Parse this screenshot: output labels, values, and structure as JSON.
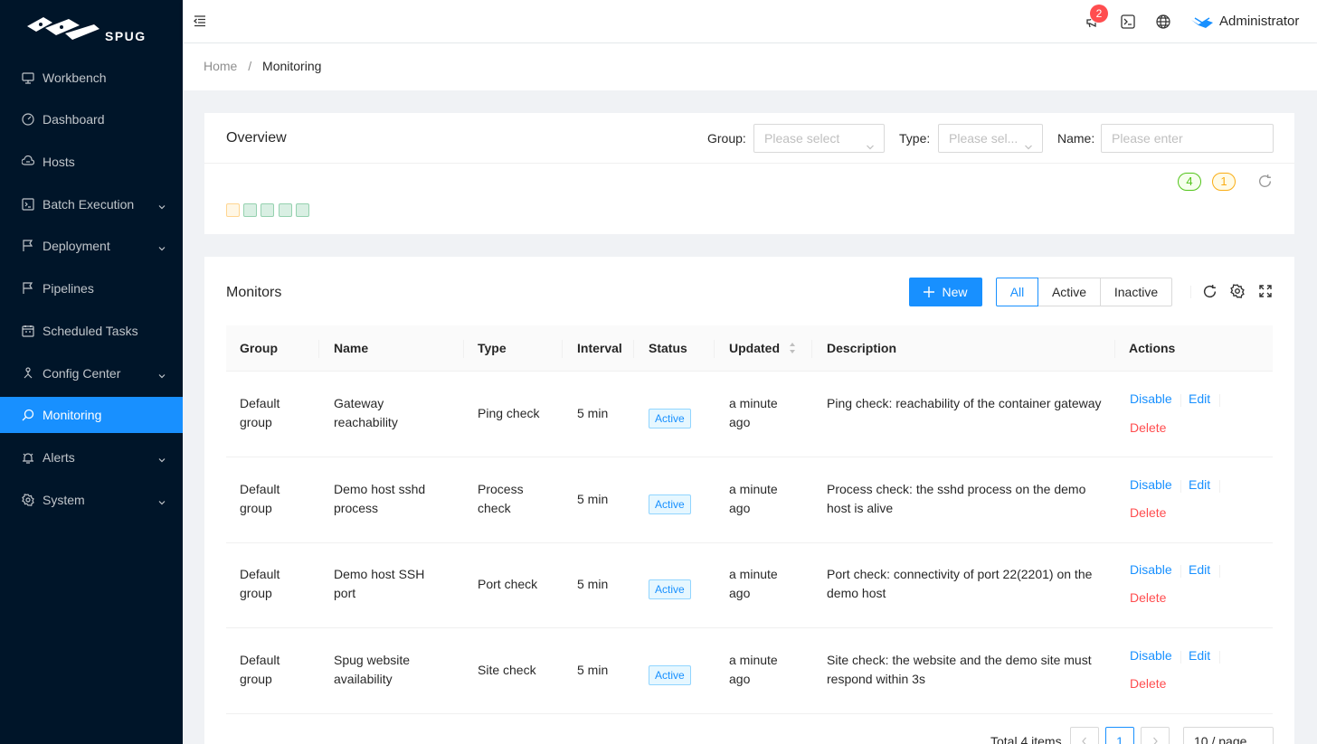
{
  "app": {
    "logo_text": "SPUG"
  },
  "sidebar": {
    "items": [
      {
        "label": "Workbench",
        "icon": "desktop-icon"
      },
      {
        "label": "Dashboard",
        "icon": "dashboard-icon"
      },
      {
        "label": "Hosts",
        "icon": "cloud-server-icon"
      },
      {
        "label": "Batch Execution",
        "icon": "code-icon",
        "expandable": true
      },
      {
        "label": "Deployment",
        "icon": "flag-icon",
        "expandable": true
      },
      {
        "label": "Pipelines",
        "icon": "flag-icon"
      },
      {
        "label": "Scheduled Tasks",
        "icon": "schedule-icon"
      },
      {
        "label": "Config Center",
        "icon": "deployment-unit-icon",
        "expandable": true
      },
      {
        "label": "Monitoring",
        "icon": "monitor-icon",
        "active": true
      },
      {
        "label": "Alerts",
        "icon": "alert-icon",
        "expandable": true
      },
      {
        "label": "System",
        "icon": "setting-icon",
        "expandable": true
      }
    ]
  },
  "header": {
    "notification_count": "2",
    "user_name": "Administrator"
  },
  "breadcrumb": {
    "home": "Home",
    "separator": "/",
    "current": "Monitoring"
  },
  "overview": {
    "title": "Overview",
    "group_label": "Group:",
    "group_placeholder": "Please select",
    "type_label": "Type:",
    "type_placeholder": "Please sel...",
    "name_label": "Name:",
    "name_placeholder": "Please enter",
    "ok_count": "4",
    "warn_count": "1",
    "status_squares": [
      "warning",
      "ok",
      "ok",
      "ok",
      "ok"
    ]
  },
  "monitors": {
    "title": "Monitors",
    "new_label": "New",
    "filters": [
      "All",
      "Active",
      "Inactive"
    ],
    "active_filter": "All",
    "columns": [
      "Group",
      "Name",
      "Type",
      "Interval",
      "Status",
      "Updated",
      "Description",
      "Actions"
    ],
    "rows": [
      {
        "group": "Default group",
        "name": "Gateway reachability",
        "type": "Ping check",
        "interval": "5 min",
        "status": "Active",
        "updated": "a minute ago",
        "description": "Ping check: reachability of the container gateway"
      },
      {
        "group": "Default group",
        "name": "Demo host sshd process",
        "type": "Process check",
        "interval": "5 min",
        "status": "Active",
        "updated": "a minute ago",
        "description": "Process check: the sshd process on the demo host is alive"
      },
      {
        "group": "Default group",
        "name": "Demo host SSH port",
        "type": "Port check",
        "interval": "5 min",
        "status": "Active",
        "updated": "a minute ago",
        "description": "Port check: connectivity of port 22(2201) on the demo host"
      },
      {
        "group": "Default group",
        "name": "Spug website availability",
        "type": "Site check",
        "interval": "5 min",
        "status": "Active",
        "updated": "a minute ago",
        "description": "Site check: the website and the demo site must respond within 3s"
      }
    ],
    "actions": {
      "disable": "Disable",
      "edit": "Edit",
      "delete": "Delete"
    },
    "pagination": {
      "total": "Total 4 items",
      "current_page": "1",
      "page_size": "10 / page"
    }
  },
  "colors": {
    "primary": "#1890ff",
    "sidebar_bg": "#001529",
    "danger": "#ff4d4f",
    "success": "#52c41a",
    "warning": "#faad14"
  }
}
